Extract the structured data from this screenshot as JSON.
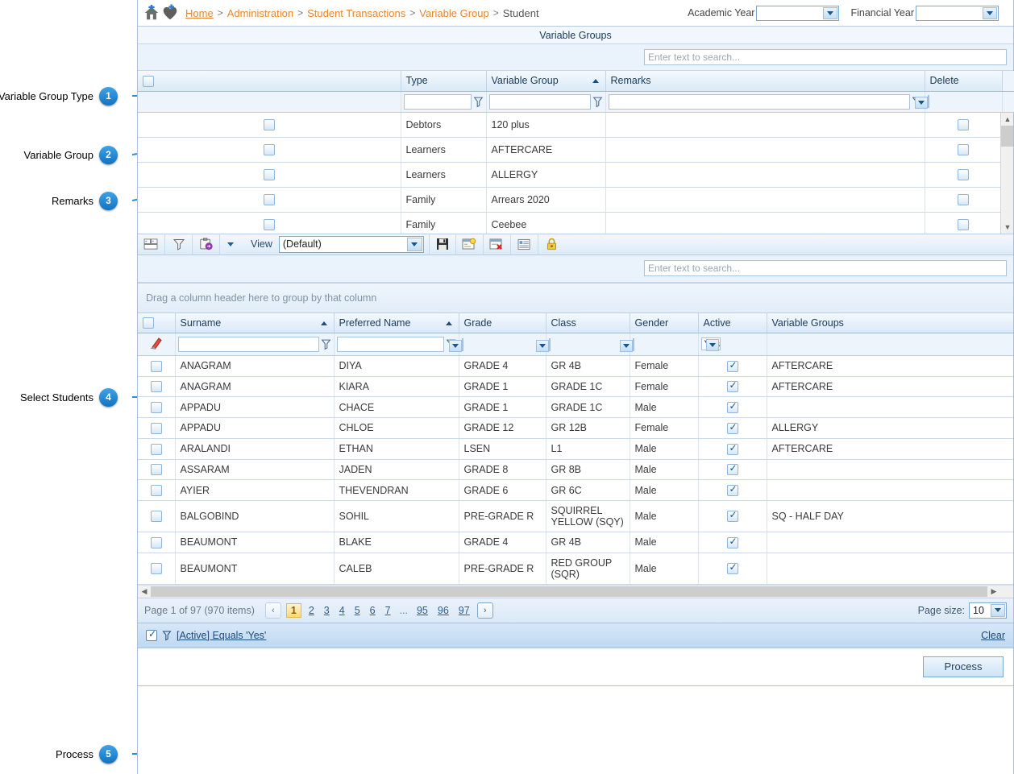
{
  "breadcrumb": {
    "items": [
      "Home",
      "Administration",
      "Student Transactions",
      "Variable Group",
      "Student"
    ],
    "separator": ">"
  },
  "header": {
    "academic_year_label": "Academic Year",
    "academic_year_value": "",
    "financial_year_label": "Financial Year",
    "financial_year_value": ""
  },
  "variable_groups_panel": {
    "title": "Variable Groups",
    "search_placeholder": "Enter text to search...",
    "search_value": "",
    "columns": [
      "",
      "Type",
      "Variable Group",
      "Remarks",
      "Delete"
    ],
    "sorted_column": "Variable Group",
    "sort_direction": "asc",
    "filters": {
      "type": "",
      "variable_group": "",
      "remarks": "",
      "delete": ""
    },
    "rows": [
      {
        "select": false,
        "type": "Debtors",
        "variable_group": "120 plus",
        "remarks": "",
        "delete": false
      },
      {
        "select": false,
        "type": "Learners",
        "variable_group": "AFTERCARE",
        "remarks": "",
        "delete": false
      },
      {
        "select": false,
        "type": "Learners",
        "variable_group": "ALLERGY",
        "remarks": "",
        "delete": false
      },
      {
        "select": false,
        "type": "Family",
        "variable_group": "Arrears 2020",
        "remarks": "",
        "delete": false
      },
      {
        "select": false,
        "type": "Family",
        "variable_group": "Ceebee",
        "remarks": "",
        "delete": false
      }
    ]
  },
  "toolbar": {
    "view_label": "View",
    "view_value": "(Default)",
    "buttons": [
      "layout-icon",
      "filter-icon",
      "export-icon",
      "dropdown-arrow",
      "save-icon",
      "new-view-icon",
      "delete-view-icon",
      "columns-icon",
      "lock-icon"
    ]
  },
  "students_panel": {
    "search_placeholder": "Enter text to search...",
    "search_value": "",
    "group_hint": "Drag a column header here to group by that column",
    "columns": [
      "",
      "Surname",
      "Preferred Name",
      "Grade",
      "Class",
      "Gender",
      "Active",
      "Variable Groups"
    ],
    "sorted_columns": [
      "Surname",
      "Preferred Name"
    ],
    "filters": {
      "surname": "",
      "preferred_name": "",
      "grade": "",
      "class": "",
      "gender": "",
      "active": "Yes",
      "variable_groups": ""
    },
    "rows": [
      {
        "select": false,
        "surname": "ANAGRAM",
        "preferred_name": "DIYA",
        "grade": "GRADE 4",
        "class": "GR 4B",
        "gender": "Female",
        "active": true,
        "variable_groups": "AFTERCARE"
      },
      {
        "select": false,
        "surname": "ANAGRAM",
        "preferred_name": "KIARA",
        "grade": "GRADE 1",
        "class": "GRADE 1C",
        "gender": "Female",
        "active": true,
        "variable_groups": "AFTERCARE"
      },
      {
        "select": false,
        "surname": "APPADU",
        "preferred_name": "CHACE",
        "grade": "GRADE 1",
        "class": "GRADE 1C",
        "gender": "Male",
        "active": true,
        "variable_groups": ""
      },
      {
        "select": false,
        "surname": "APPADU",
        "preferred_name": "CHLOE",
        "grade": "GRADE 12",
        "class": "GR 12B",
        "gender": "Female",
        "active": true,
        "variable_groups": "ALLERGY"
      },
      {
        "select": false,
        "surname": "ARALANDI",
        "preferred_name": "ETHAN",
        "grade": "LSEN",
        "class": "L1",
        "gender": "Male",
        "active": true,
        "variable_groups": "AFTERCARE"
      },
      {
        "select": false,
        "surname": "ASSARAM",
        "preferred_name": "JADEN",
        "grade": "GRADE 8",
        "class": "GR 8B",
        "gender": "Male",
        "active": true,
        "variable_groups": ""
      },
      {
        "select": false,
        "surname": "AYIER",
        "preferred_name": "THEVENDRAN",
        "grade": "GRADE 6",
        "class": "GR 6C",
        "gender": "Male",
        "active": true,
        "variable_groups": ""
      },
      {
        "select": false,
        "surname": "BALGOBIND",
        "preferred_name": "SOHIL",
        "grade": "PRE-GRADE R",
        "class": "SQUIRREL YELLOW (SQY)",
        "gender": "Male",
        "active": true,
        "variable_groups": "SQ - HALF DAY"
      },
      {
        "select": false,
        "surname": "BEAUMONT",
        "preferred_name": "BLAKE",
        "grade": "GRADE 4",
        "class": "GR 4B",
        "gender": "Male",
        "active": true,
        "variable_groups": ""
      },
      {
        "select": false,
        "surname": "BEAUMONT",
        "preferred_name": "CALEB",
        "grade": "PRE-GRADE R",
        "class": "RED GROUP (SQR)",
        "gender": "Male",
        "active": true,
        "variable_groups": ""
      }
    ]
  },
  "pager": {
    "info": "Page 1 of 97 (970 items)",
    "current": "1",
    "pages": [
      "1",
      "2",
      "3",
      "4",
      "5",
      "6",
      "7"
    ],
    "ellipsis": "...",
    "tail_pages": [
      "95",
      "96",
      "97"
    ],
    "prev_glyph": "‹",
    "next_glyph": "›",
    "page_size_label": "Page size:",
    "page_size_value": "10"
  },
  "filter_summary": {
    "enabled": true,
    "text": "[Active] Equals 'Yes'",
    "clear_label": "Clear"
  },
  "footer": {
    "process_label": "Process"
  },
  "annotations": [
    {
      "n": "1",
      "label": "Variable Group Type"
    },
    {
      "n": "2",
      "label": "Variable Group"
    },
    {
      "n": "3",
      "label": "Remarks"
    },
    {
      "n": "4",
      "label": "Select Students"
    },
    {
      "n": "5",
      "label": "Process"
    }
  ],
  "colors": {
    "accent": "#1c87d8",
    "breadcrumb_link": "#e8862a",
    "header_text": "#1a3a5c",
    "grid_header_bg": "#dbe9f7",
    "filter_bar_bg": "#bed8f0"
  }
}
